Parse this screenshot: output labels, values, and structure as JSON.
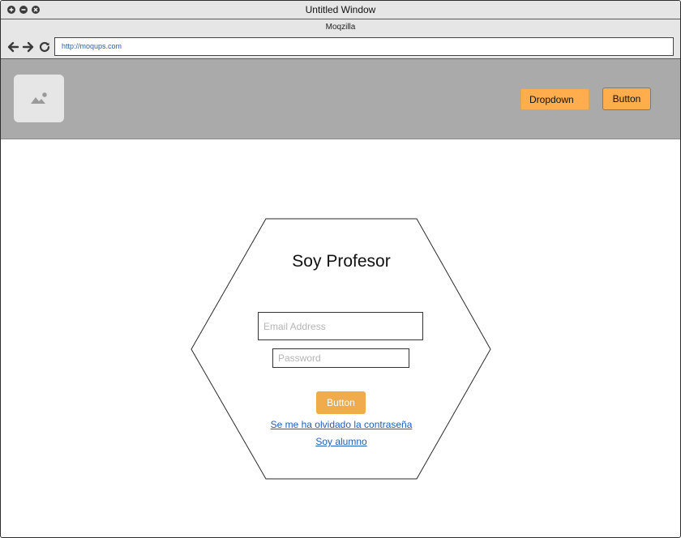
{
  "window": {
    "title": "Untitled Window"
  },
  "browser": {
    "title": "Moqzilla",
    "url": "http://moqups.com"
  },
  "header": {
    "dropdown_label": "Dropdown",
    "button_label": "Button"
  },
  "form": {
    "title": "Soy Profesor",
    "email_placeholder": "Email Address",
    "password_placeholder": "Password",
    "submit_label": "Button",
    "forgot_link": "Se me ha olvidado la contraseña",
    "student_link": "Soy alumno"
  },
  "colors": {
    "accent": "#ffad4d",
    "header_bg": "#aaaaaa",
    "link": "#1f5fb8"
  }
}
